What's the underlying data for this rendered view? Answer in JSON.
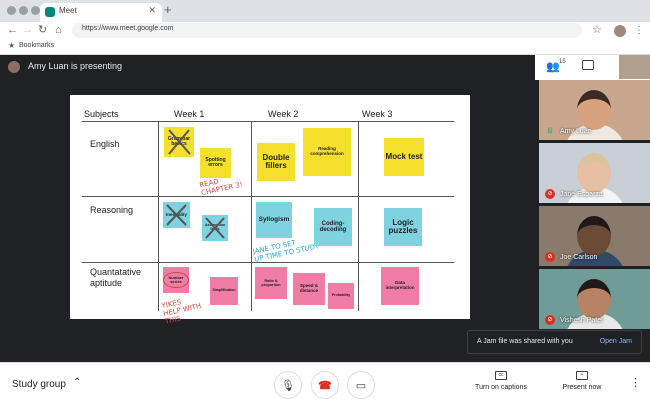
{
  "browser": {
    "tab_title": "Meet",
    "tab_close": "✕",
    "new_tab": "+",
    "url": "https://www.meet.google.com",
    "bookmarks_label": "Bookmarks"
  },
  "meet": {
    "presenter_text": "Amy Luan is presenting",
    "people_count": "15",
    "slide": {
      "headers": [
        "Subjects",
        "Week 1",
        "Week 2",
        "Week 3"
      ],
      "rows": [
        "English",
        "Reasoning",
        "Quantatative aptitude"
      ],
      "notes": {
        "grammar": "Grammar basics",
        "spotting": "Spotting errors",
        "double": "Double fillers",
        "reading": "Reading comprehension",
        "mock": "Mock test",
        "inequality": "Inequality",
        "assumption": "Assumption fields",
        "syllogism": "Syllogism",
        "coding": "Coding-decoding",
        "logic": "Logic puzzles",
        "number": "Number series",
        "simplification": "Simplification",
        "ratio": "Ratio & proportion",
        "speed": "Speed & distance",
        "probability": "Probability",
        "data": "Data interpretation"
      },
      "handwriting": {
        "read": "READ\nCHAPTER 3!",
        "jane": "JANE TO SET\nUP TIME TO STUDY",
        "yikes": "YIKES\nHELP WITH\nTHIS"
      }
    },
    "participants": [
      {
        "name": "Amy Luan",
        "muted": false,
        "bg": "#c9a78e",
        "skin": "#d8a27f",
        "hair": "#3b2b24",
        "shirt": "#efe9e2"
      },
      {
        "name": "Jane Esparza",
        "muted": true,
        "bg": "#c9cfd6",
        "skin": "#e6bfa5",
        "hair": "#d9c49c",
        "shirt": "#f4f4f4"
      },
      {
        "name": "Joe Carlson",
        "muted": true,
        "bg": "#8a7a6c",
        "skin": "#6b4a36",
        "hair": "#1f1a18",
        "shirt": "#2f4a66"
      },
      {
        "name": "Vishesh Patel",
        "muted": true,
        "bg": "#6f9c96",
        "skin": "#b88364",
        "hair": "#1f1a18",
        "shirt": "#e8e8e8"
      }
    ],
    "toast": {
      "text": "A Jam file was shared with you",
      "action": "Open Jam"
    }
  },
  "bottom_bar": {
    "meeting_name": "Study group",
    "captions_label": "Turn on captions",
    "present_label": "Present now"
  }
}
